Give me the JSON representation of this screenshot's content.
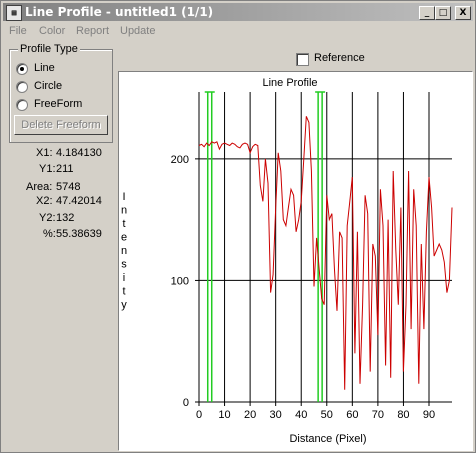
{
  "window": {
    "title": "Line Profile - untitled1 (1/1)",
    "controls": {
      "minimize": "_",
      "maximize": "□",
      "close": "X"
    }
  },
  "menu": [
    "File",
    "Color",
    "Report",
    "Update"
  ],
  "profile_type": {
    "legend": "Profile Type",
    "options": [
      "Line",
      "Circle",
      "FreeForm"
    ],
    "selected": "Line",
    "delete_button": "Delete Freeform"
  },
  "stats": [
    {
      "label": "X1:",
      "value": "4.184130"
    },
    {
      "label": "Y1:",
      "value": "211"
    },
    {
      "label": "Area:",
      "value": "5748"
    },
    {
      "label": "X2:",
      "value": "47.42014"
    },
    {
      "label": "Y2:",
      "value": "132"
    },
    {
      "label": "%:",
      "value": "55.38639"
    }
  ],
  "reference": {
    "label": "Reference",
    "checked": false
  },
  "colors": {
    "profile_line": "#cc0000",
    "marker_line": "#22cc22",
    "marker_highlight": "#2244cc",
    "grid": "#000000"
  },
  "chart_data": {
    "type": "line",
    "title": "Line Profile",
    "xlabel": "Distance (Pixel)",
    "ylabel": "Intensity",
    "xlim": [
      0,
      99
    ],
    "ylim": [
      0,
      255
    ],
    "x_ticks": [
      0,
      10,
      20,
      30,
      40,
      50,
      60,
      70,
      80,
      90
    ],
    "y_ticks": [
      0,
      100,
      200
    ],
    "grid": true,
    "markers_x": [
      4.2,
      47.4
    ],
    "series": [
      {
        "x": [
          0,
          1,
          2,
          3,
          4,
          5,
          6,
          7,
          8,
          9,
          10,
          11,
          12,
          13,
          14,
          15,
          16,
          17,
          18,
          19,
          20,
          21,
          22,
          23,
          24,
          25,
          26,
          27,
          28,
          29,
          30,
          31,
          32,
          33,
          34,
          35,
          36,
          37,
          38,
          39,
          40,
          41,
          42,
          43,
          44,
          45,
          46,
          47,
          48,
          49,
          50,
          51,
          52,
          53,
          54,
          55,
          56,
          57,
          58,
          59,
          60,
          61,
          62,
          63,
          64,
          65,
          66,
          67,
          68,
          69,
          70,
          71,
          72,
          73,
          74,
          75,
          76,
          77,
          78,
          79,
          80,
          81,
          82,
          83,
          84,
          85,
          86,
          87,
          88,
          89,
          90,
          91,
          92,
          93,
          94,
          95,
          96,
          97,
          98,
          99
        ],
        "values": [
          211,
          212,
          210,
          213,
          211,
          214,
          213,
          214,
          208,
          212,
          213,
          212,
          211,
          213,
          212,
          210,
          209,
          212,
          213,
          212,
          205,
          210,
          212,
          211,
          178,
          165,
          200,
          180,
          90,
          105,
          160,
          205,
          190,
          150,
          145,
          160,
          175,
          170,
          140,
          150,
          165,
          200,
          235,
          230,
          190,
          95,
          135,
          110,
          85,
          80,
          170,
          150,
          155,
          110,
          75,
          140,
          135,
          10,
          145,
          165,
          185,
          40,
          140,
          15,
          80,
          170,
          155,
          25,
          130,
          120,
          55,
          175,
          145,
          30,
          150,
          20,
          190,
          125,
          80,
          160,
          25,
          80,
          190,
          60,
          175,
          145,
          15,
          130,
          60,
          140,
          185,
          160,
          120,
          125,
          130,
          125,
          115,
          90,
          100,
          160
        ]
      }
    ]
  }
}
